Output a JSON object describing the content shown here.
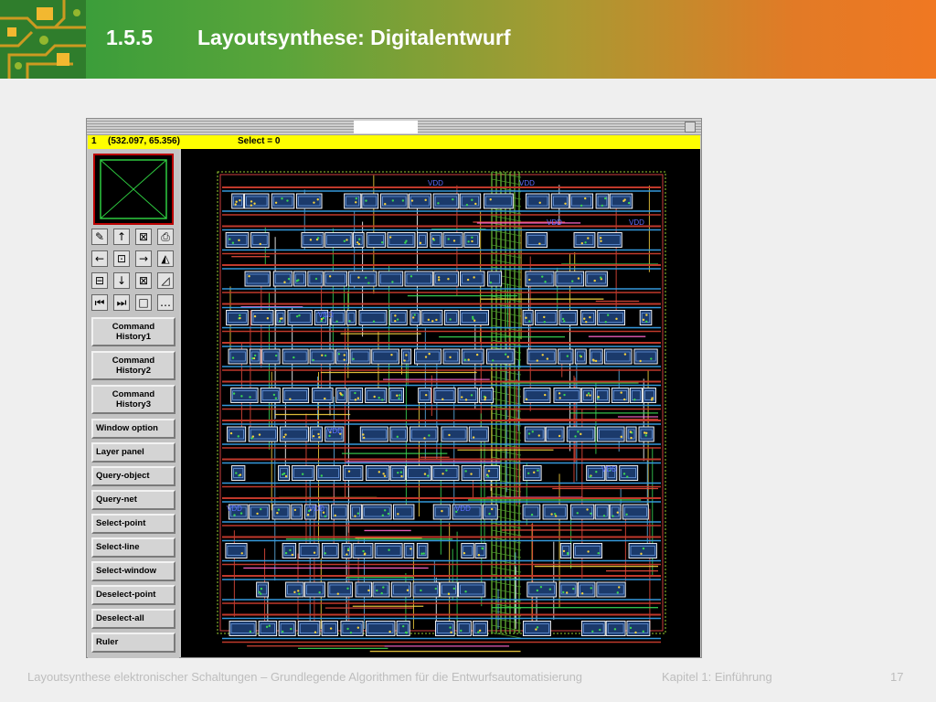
{
  "slide": {
    "number": "1.5.5",
    "title": "Layoutsynthese: Digitalentwurf"
  },
  "window": {
    "status": {
      "id": "1",
      "coords": "(532.097, 65.356)",
      "select": "Select = 0"
    },
    "icons": [
      "edit-icon",
      "arrow-up-icon",
      "box-x-icon",
      "print-icon",
      "arrow-left-icon",
      "zoom-icon",
      "arrow-right-icon",
      "measure-icon",
      "save-icon",
      "arrow-down-icon",
      "box-x2-icon",
      "area-icon",
      "rewind-icon",
      "fast-forward-icon",
      "square-icon",
      "more-icon"
    ],
    "icon_glyphs": [
      "✎",
      "↑",
      "⊠",
      "⎙",
      "←",
      "⊡",
      "→",
      "◭",
      "⊟",
      "↓",
      "⊠",
      "◿",
      "⏮",
      "⏭",
      "□",
      "…"
    ],
    "command_history": [
      {
        "line1": "Command",
        "line2": "History1"
      },
      {
        "line1": "Command",
        "line2": "History2"
      },
      {
        "line1": "Command",
        "line2": "History3"
      }
    ],
    "tools": [
      "Window option",
      "Layer panel",
      "Query-object",
      "Query-net",
      "Select-point",
      "Select-line",
      "Select-window",
      "Deselect-point",
      "Deselect-all",
      "Ruler"
    ],
    "layout_label": "VDD"
  },
  "footer": {
    "course": "Layoutsynthese elektronischer Schaltungen – Grundlegende Algorithmen für die Entwurfsautomatisierung",
    "chapter": "Kapitel 1: Einführung",
    "page": "17"
  },
  "colors": {
    "status_bar": "#ffff00",
    "canvas": "#000000",
    "header_start": "#2e9a3a",
    "header_end": "#f07822"
  }
}
